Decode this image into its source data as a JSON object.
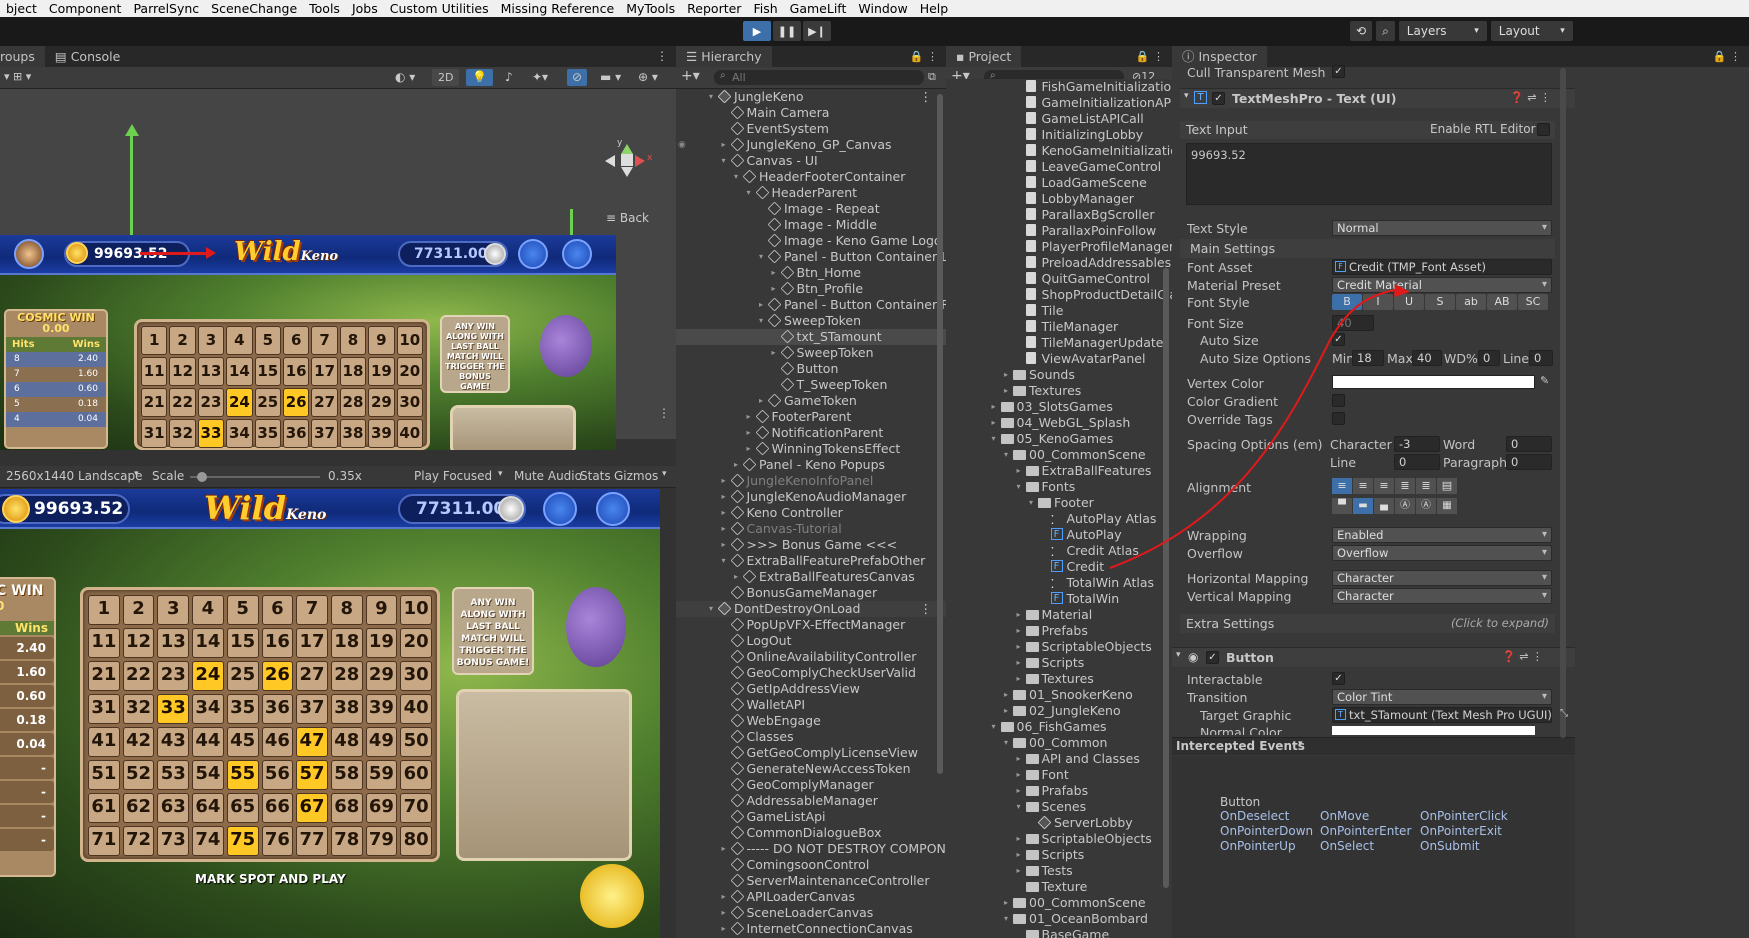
{
  "menu": [
    "bject",
    "Component",
    "ParrelSync",
    "SceneChange",
    "Tools",
    "Jobs",
    "Custom Utilities",
    "Missing Reference",
    "MyTools",
    "Reporter",
    "Fish",
    "GameLift",
    "Window",
    "Help"
  ],
  "toolbar": {
    "layers_label": "Layers",
    "layout_label": "Layout"
  },
  "scene": {
    "tab_groups": "roups",
    "tab_console": "Console",
    "btn_2d": "2D",
    "back_label": "Back",
    "balance": "99693.52",
    "jackpot": "77311.00",
    "logo_wild": "Wild",
    "logo_keno": "Keno",
    "cosmic_win": "COSMIC WIN",
    "cosmic_value": "0.00",
    "hits_header": "Hits",
    "wins_header": "Wins",
    "wins_rows": [
      {
        "hits": "8",
        "wins": "2.40"
      },
      {
        "hits": "7",
        "wins": "1.60"
      },
      {
        "hits": "6",
        "wins": "0.60"
      },
      {
        "hits": "5",
        "wins": "0.18"
      },
      {
        "hits": "4",
        "wins": "0.04"
      }
    ],
    "stone_text": "ANY WIN ALONG WITH LAST BALL MATCH WILL TRIGGER THE BONUS GAME!"
  },
  "game": {
    "resolution": "2560x1440 Landscape",
    "scale_label": "Scale",
    "scale_value": "0.35x",
    "scale_pct": 0.05,
    "play_focused": "Play Focused",
    "mute_audio": "Mute Audio",
    "stats": "Stats",
    "gizmos": "Gizmos",
    "balance": "99693.52",
    "jackpot": "77311.00",
    "win_label": "C WIN",
    "win_value": "0",
    "wins_header": "Wins",
    "wins_values": [
      "2.40",
      "1.60",
      "0.60",
      "0.18",
      "0.04",
      "-",
      "-",
      "-",
      "-"
    ],
    "mark_spot": "MARK SPOT AND PLAY",
    "highlighted": [
      24,
      26,
      33,
      47,
      55,
      57,
      67,
      75
    ]
  },
  "hierarchy": {
    "tab": "Hierarchy",
    "search_placeholder": "All",
    "rows": [
      {
        "label": "JungleKeno",
        "indent": 0,
        "arrow": "▾",
        "icon": "scene",
        "menu": true
      },
      {
        "label": "Main Camera",
        "indent": 1,
        "arrow": "",
        "icon": "cube"
      },
      {
        "label": "EventSystem",
        "indent": 1,
        "arrow": "",
        "icon": "cube"
      },
      {
        "label": "JungleKeno_GP_Canvas",
        "indent": 1,
        "arrow": "▸",
        "icon": "cube",
        "eye": true
      },
      {
        "label": "Canvas - UI",
        "indent": 1,
        "arrow": "▾",
        "icon": "cube"
      },
      {
        "label": "HeaderFooterContainer",
        "indent": 2,
        "arrow": "▾",
        "icon": "cube"
      },
      {
        "label": "HeaderParent",
        "indent": 3,
        "arrow": "▾",
        "icon": "cube"
      },
      {
        "label": "Image - Repeat",
        "indent": 4,
        "arrow": "",
        "icon": "cube"
      },
      {
        "label": "Image - Middle",
        "indent": 4,
        "arrow": "",
        "icon": "cube"
      },
      {
        "label": "Image - Keno Game Logo",
        "indent": 4,
        "arrow": "",
        "icon": "cube"
      },
      {
        "label": "Panel - Button Container Left",
        "indent": 4,
        "arrow": "▾",
        "icon": "cube"
      },
      {
        "label": "Btn_Home",
        "indent": 5,
        "arrow": "▸",
        "icon": "cube"
      },
      {
        "label": "Btn_Profile",
        "indent": 5,
        "arrow": "▸",
        "icon": "cube"
      },
      {
        "label": "Panel - Button Container Righ",
        "indent": 4,
        "arrow": "▸",
        "icon": "cube"
      },
      {
        "label": "SweepToken",
        "indent": 4,
        "arrow": "▾",
        "icon": "cube"
      },
      {
        "label": "txt_STamount",
        "indent": 5,
        "arrow": "",
        "icon": "cube",
        "sel": true
      },
      {
        "label": "SweepToken",
        "indent": 5,
        "arrow": "▸",
        "icon": "cube"
      },
      {
        "label": "Button",
        "indent": 5,
        "arrow": "",
        "icon": "cube"
      },
      {
        "label": "T_SweepToken",
        "indent": 5,
        "arrow": "",
        "icon": "cube"
      },
      {
        "label": "GameToken",
        "indent": 4,
        "arrow": "▸",
        "icon": "cube"
      },
      {
        "label": "FooterParent",
        "indent": 3,
        "arrow": "▸",
        "icon": "cube"
      },
      {
        "label": "NotificationParent",
        "indent": 3,
        "arrow": "▸",
        "icon": "cube"
      },
      {
        "label": "WinningTokensEffect",
        "indent": 3,
        "arrow": "▸",
        "icon": "cube"
      },
      {
        "label": "Panel - Keno Popups",
        "indent": 2,
        "arrow": "▸",
        "icon": "cube"
      },
      {
        "label": "JungleKenoInfoPanel",
        "indent": 1,
        "arrow": "▸",
        "icon": "cube",
        "dis": true
      },
      {
        "label": "JungleKenoAudioManager",
        "indent": 1,
        "arrow": "▸",
        "icon": "cube"
      },
      {
        "label": "Keno Controller",
        "indent": 1,
        "arrow": "▸",
        "icon": "cube"
      },
      {
        "label": "Canvas-Tutorial",
        "indent": 1,
        "arrow": "▸",
        "icon": "cube",
        "dis": true
      },
      {
        "label": ">>> Bonus Game <<<",
        "indent": 1,
        "arrow": "▸",
        "icon": "cube"
      },
      {
        "label": "ExtraBallFeaturePrefabOther",
        "indent": 1,
        "arrow": "▾",
        "icon": "cube"
      },
      {
        "label": "ExtraBallFeaturesCanvas",
        "indent": 2,
        "arrow": "▸",
        "icon": "cube"
      },
      {
        "label": "BonusGameManager",
        "indent": 1,
        "arrow": "",
        "icon": "cube"
      },
      {
        "label": "DontDestroyOnLoad",
        "indent": 0,
        "arrow": "▾",
        "icon": "scene",
        "menu": true,
        "hdr": true
      },
      {
        "label": "PopUpVFX-EffectManager",
        "indent": 1,
        "arrow": "",
        "icon": "cube"
      },
      {
        "label": "LogOut",
        "indent": 1,
        "arrow": "",
        "icon": "cube"
      },
      {
        "label": "OnlineAvailabilityController",
        "indent": 1,
        "arrow": "",
        "icon": "cube"
      },
      {
        "label": "GeoComplyCheckUserValid",
        "indent": 1,
        "arrow": "",
        "icon": "cube"
      },
      {
        "label": "GetIpAddressView",
        "indent": 1,
        "arrow": "",
        "icon": "cube"
      },
      {
        "label": "WalletAPI",
        "indent": 1,
        "arrow": "",
        "icon": "cube"
      },
      {
        "label": "WebEngage",
        "indent": 1,
        "arrow": "",
        "icon": "cube"
      },
      {
        "label": "Classes",
        "indent": 1,
        "arrow": "",
        "icon": "cube"
      },
      {
        "label": "GetGeoComplyLicenseView",
        "indent": 1,
        "arrow": "",
        "icon": "cube"
      },
      {
        "label": "GenerateNewAccessToken",
        "indent": 1,
        "arrow": "",
        "icon": "cube"
      },
      {
        "label": "GeoComplyManager",
        "indent": 1,
        "arrow": "",
        "icon": "cube"
      },
      {
        "label": "AddressableManager",
        "indent": 1,
        "arrow": "",
        "icon": "cube"
      },
      {
        "label": "GameListApi",
        "indent": 1,
        "arrow": "",
        "icon": "cube"
      },
      {
        "label": "CommonDialogueBox",
        "indent": 1,
        "arrow": "",
        "icon": "cube"
      },
      {
        "label": "----- DO NOT DESTROY COMPONEN",
        "indent": 1,
        "arrow": "▸",
        "icon": "cube"
      },
      {
        "label": "ComingsoonControl",
        "indent": 1,
        "arrow": "",
        "icon": "cube"
      },
      {
        "label": "ServerMaintenanceController",
        "indent": 1,
        "arrow": "",
        "icon": "cube"
      },
      {
        "label": "APILoaderCanvas",
        "indent": 1,
        "arrow": "▸",
        "icon": "cube"
      },
      {
        "label": "SceneLoaderCanvas",
        "indent": 1,
        "arrow": "▸",
        "icon": "cube"
      },
      {
        "label": "InternetConnectionCanvas",
        "indent": 1,
        "arrow": "▸",
        "icon": "cube"
      }
    ]
  },
  "project": {
    "tab": "Project",
    "hidden_count": "12",
    "rows": [
      {
        "label": "FishGameInitializationAPI",
        "indent": 3,
        "icon": "script"
      },
      {
        "label": "GameInitializationAPIHan",
        "indent": 3,
        "icon": "script"
      },
      {
        "label": "GameListAPICall",
        "indent": 3,
        "icon": "script"
      },
      {
        "label": "InitializingLobby",
        "indent": 3,
        "icon": "script"
      },
      {
        "label": "KenoGameInitializationAF",
        "indent": 3,
        "icon": "script"
      },
      {
        "label": "LeaveGameControl",
        "indent": 3,
        "icon": "script"
      },
      {
        "label": "LoadGameScene",
        "indent": 3,
        "icon": "script"
      },
      {
        "label": "LobbyManager",
        "indent": 3,
        "icon": "script"
      },
      {
        "label": "ParallaxBgScroller",
        "indent": 3,
        "icon": "script"
      },
      {
        "label": "ParallaxPoinFollow",
        "indent": 3,
        "icon": "script"
      },
      {
        "label": "PlayerProfileManager",
        "indent": 3,
        "icon": "script"
      },
      {
        "label": "PreloadAddressables",
        "indent": 3,
        "icon": "script"
      },
      {
        "label": "QuitGameControl",
        "indent": 3,
        "icon": "script"
      },
      {
        "label": "ShopProductDetailClass",
        "indent": 3,
        "icon": "script"
      },
      {
        "label": "Tile",
        "indent": 3,
        "icon": "script"
      },
      {
        "label": "TileManager",
        "indent": 3,
        "icon": "script"
      },
      {
        "label": "TileManagerUpdate",
        "indent": 3,
        "icon": "script"
      },
      {
        "label": "ViewAvatarPanel",
        "indent": 3,
        "icon": "script"
      },
      {
        "label": "Sounds",
        "indent": 2,
        "arrow": "▸",
        "icon": "folder"
      },
      {
        "label": "Textures",
        "indent": 2,
        "arrow": "▸",
        "icon": "folder"
      },
      {
        "label": "03_SlotsGames",
        "indent": 1,
        "arrow": "▸",
        "icon": "folder"
      },
      {
        "label": "04_WebGL_Splash",
        "indent": 1,
        "arrow": "▸",
        "icon": "folder"
      },
      {
        "label": "05_KenoGames",
        "indent": 1,
        "arrow": "▾",
        "icon": "folder"
      },
      {
        "label": "00_CommonScene",
        "indent": 2,
        "arrow": "▾",
        "icon": "folder"
      },
      {
        "label": "ExtraBallFeatures",
        "indent": 3,
        "arrow": "▸",
        "icon": "folder"
      },
      {
        "label": "Fonts",
        "indent": 3,
        "arrow": "▾",
        "icon": "folder"
      },
      {
        "label": "Footer",
        "indent": 4,
        "arrow": "▾",
        "icon": "folder"
      },
      {
        "label": "AutoPlay Atlas",
        "indent": 5,
        "icon": "atlas"
      },
      {
        "label": "AutoPlay",
        "indent": 5,
        "icon": "font"
      },
      {
        "label": "Credit Atlas",
        "indent": 5,
        "icon": "atlas"
      },
      {
        "label": "Credit",
        "indent": 5,
        "icon": "font"
      },
      {
        "label": "TotalWin Atlas",
        "indent": 5,
        "icon": "atlas"
      },
      {
        "label": "TotalWin",
        "indent": 5,
        "icon": "font"
      },
      {
        "label": "Material",
        "indent": 3,
        "arrow": "▸",
        "icon": "folder"
      },
      {
        "label": "Prefabs",
        "indent": 3,
        "arrow": "▸",
        "icon": "folder"
      },
      {
        "label": "ScriptableObjects",
        "indent": 3,
        "arrow": "▸",
        "icon": "folder"
      },
      {
        "label": "Scripts",
        "indent": 3,
        "arrow": "▸",
        "icon": "folder"
      },
      {
        "label": "Textures",
        "indent": 3,
        "arrow": "▸",
        "icon": "folder"
      },
      {
        "label": "01_SnookerKeno",
        "indent": 2,
        "arrow": "▸",
        "icon": "folder"
      },
      {
        "label": "02_JungleKeno",
        "indent": 2,
        "arrow": "▸",
        "icon": "folder"
      },
      {
        "label": "06_FishGames",
        "indent": 1,
        "arrow": "▾",
        "icon": "folder"
      },
      {
        "label": "00_Common",
        "indent": 2,
        "arrow": "▾",
        "icon": "folder"
      },
      {
        "label": "API and Classes",
        "indent": 3,
        "arrow": "▸",
        "icon": "folder"
      },
      {
        "label": "Font",
        "indent": 3,
        "arrow": "▸",
        "icon": "folder"
      },
      {
        "label": "Prafabs",
        "indent": 3,
        "arrow": "▸",
        "icon": "folder"
      },
      {
        "label": "Scenes",
        "indent": 3,
        "arrow": "▾",
        "icon": "folder"
      },
      {
        "label": "ServerLobby",
        "indent": 4,
        "icon": "scenefile"
      },
      {
        "label": "ScriptableObjects",
        "indent": 3,
        "arrow": "▸",
        "icon": "folder"
      },
      {
        "label": "Scripts",
        "indent": 3,
        "arrow": "▸",
        "icon": "folder"
      },
      {
        "label": "Tests",
        "indent": 3,
        "arrow": "▸",
        "icon": "folder"
      },
      {
        "label": "Texture",
        "indent": 3,
        "icon": "folder"
      },
      {
        "label": "00_CommonScene",
        "indent": 2,
        "arrow": "▸",
        "icon": "folder"
      },
      {
        "label": "01_OceanBombard",
        "indent": 2,
        "arrow": "▾",
        "icon": "folder"
      },
      {
        "label": "BaseGame",
        "indent": 3,
        "icon": "folder"
      }
    ]
  },
  "inspector": {
    "tab": "Inspector",
    "cull_label": "Cull Transparent Mesh",
    "tmp_title": "TextMeshPro - Text (UI)",
    "text_input": "Text Input",
    "rtl": "Enable RTL Editor",
    "text_value": "99693.52",
    "text_style_label": "Text Style",
    "text_style": "Normal",
    "main_settings": "Main Settings",
    "font_asset_label": "Font Asset",
    "font_asset": "Credit (TMP_Font Asset)",
    "material_preset_label": "Material Preset",
    "material_preset": "Credit Material",
    "font_style_label": "Font Style",
    "font_styles": [
      "B",
      "I",
      "U",
      "S",
      "ab",
      "AB",
      "SC"
    ],
    "font_size_label": "Font Size",
    "font_size": "40",
    "auto_size_label": "Auto Size",
    "auto_size_options_label": "Auto Size Options",
    "min_label": "Min",
    "min_val": "18",
    "max_label": "Max",
    "max_val": "40",
    "wd_label": "WD%",
    "wd_val": "0",
    "line_label": "Line",
    "line_val": "0",
    "vertex_color_label": "Vertex Color",
    "color_gradient_label": "Color Gradient",
    "override_tags_label": "Override Tags",
    "spacing_label": "Spacing Options (em)",
    "character_label": "Character",
    "character_val": "-3",
    "word_label": "Word",
    "word_val": "0",
    "line2_label": "Line",
    "line2_val": "0",
    "paragraph_label": "Paragraph",
    "paragraph_val": "0",
    "alignment_label": "Alignment",
    "wrapping_label": "Wrapping",
    "wrapping": "Enabled",
    "overflow_label": "Overflow",
    "overflow": "Overflow",
    "hmap_label": "Horizontal Mapping",
    "hmap": "Character",
    "vmap_label": "Vertical Mapping",
    "vmap": "Character",
    "extra_settings": "Extra Settings",
    "click_expand": "(Click to expand)",
    "button_title": "Button",
    "interactable_label": "Interactable",
    "transition_label": "Transition",
    "transition": "Color Tint",
    "target_graphic_label": "Target Graphic",
    "target_graphic": "txt_STamount (Text Mesh Pro UGUI)",
    "normal_color_label": "Normal Color",
    "intercepted": "Intercepted Events",
    "events_header": "Button",
    "events": [
      "OnDeselect",
      "OnMove",
      "OnPointerClick",
      "OnPointerDown",
      "OnPointerEnter",
      "OnPointerExit",
      "OnPointerUp",
      "OnSelect",
      "OnSubmit"
    ]
  },
  "colors": {
    "accent": "#3d6fa8",
    "annotation": "#e0191b",
    "highlight": "#ffc824"
  }
}
